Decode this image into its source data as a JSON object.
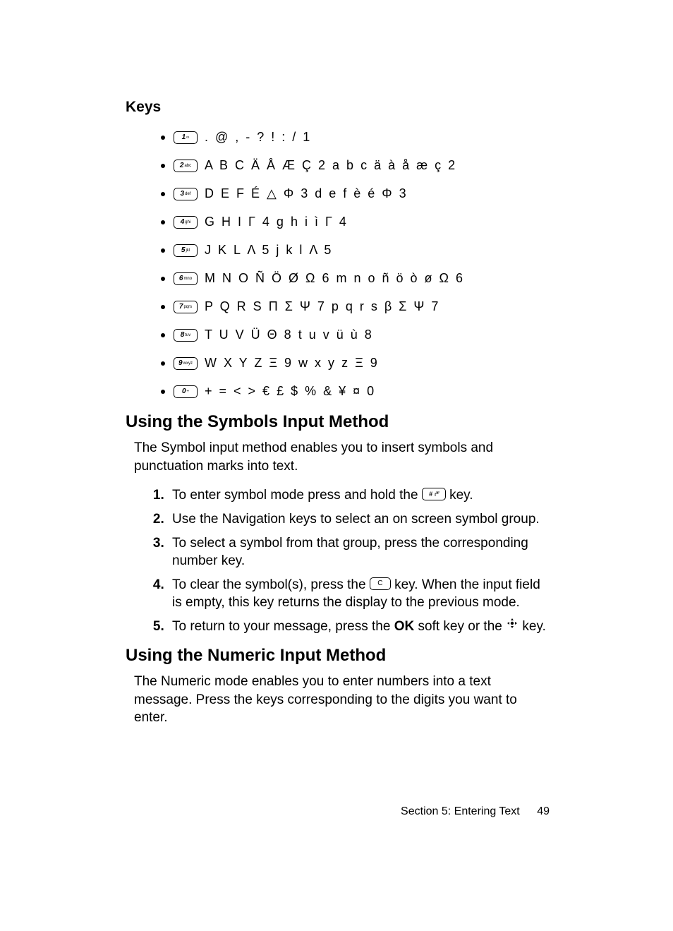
{
  "sections": {
    "keys_title": "Keys",
    "keys": [
      {
        "num": "1",
        "sub": "∞",
        "chars": ". @ , - ? ! : / 1"
      },
      {
        "num": "2",
        "sub": "abc",
        "chars": "A B C Ä Å Æ Ç 2 a b c ä à å æ ç 2"
      },
      {
        "num": "3",
        "sub": "def",
        "chars": "D E F É △ Φ 3 d e f è é Φ 3"
      },
      {
        "num": "4",
        "sub": "ghi",
        "chars": "G H I Γ 4 g h i ì Γ 4"
      },
      {
        "num": "5",
        "sub": "jkl",
        "chars": "J K L Λ 5 j k l Λ 5"
      },
      {
        "num": "6",
        "sub": "mno",
        "chars": "M N O Ñ Ö Ø Ω 6 m n o ñ ö ò ø Ω 6"
      },
      {
        "num": "7",
        "sub": "pqrs",
        "chars": "P Q R S Π Σ Ψ 7 p q r s β Σ Ψ 7"
      },
      {
        "num": "8",
        "sub": "tuv",
        "chars": "T U V Ü Θ 8 t u v ü ù 8"
      },
      {
        "num": "9",
        "sub": "wxyz",
        "chars": "W X Y Z Ξ 9 w x y z Ξ 9"
      },
      {
        "num": "0",
        "sub": "+",
        "chars": "+ = < > € £ $ % & ¥ ¤ 0"
      }
    ],
    "symbols_heading": "Using the Symbols Input Method",
    "symbols_para": "The Symbol input method enables you to insert symbols and punctuation marks into text.",
    "steps": {
      "s1_a": "To enter symbol mode press and hold the ",
      "s1_key_num": "#",
      "s1_key_sub": "",
      "s1_b": " key.",
      "s2": "Use the Navigation keys to select an on screen symbol group.",
      "s3": "To select a symbol from that group, press the corresponding number key.",
      "s4_a": "To clear the symbol(s), press the ",
      "s4_key": "C",
      "s4_b": " key. When the input field is empty, this key returns the display to the previous mode.",
      "s5_a": "To return to your message, press the ",
      "s5_ok": "OK",
      "s5_b": " soft key or the ",
      "s5_c": " key."
    },
    "numeric_heading": "Using the Numeric Input Method",
    "numeric_para": "The Numeric mode enables you to enter numbers into a text message. Press the keys corresponding to the digits you want to enter."
  },
  "footer": {
    "section": "Section 5: Entering Text",
    "page": "49"
  }
}
